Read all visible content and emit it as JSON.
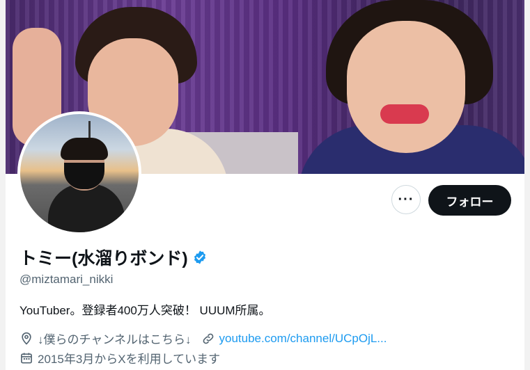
{
  "profile": {
    "display_name": "トミー(水溜りボンド)",
    "handle": "@miztamari_nikki",
    "bio": "YouTuber。登録者400万人突破！ UUUM所属。",
    "location": "↓僕らのチャンネルはこちら↓",
    "website": "youtube.com/channel/UCpOjL...",
    "joined": "2015年3月からXを利用しています",
    "verified": true
  },
  "actions": {
    "more_label": "···",
    "follow_label": "フォロー"
  },
  "colors": {
    "accent": "#1d9bf0",
    "text_primary": "#0f1419",
    "text_secondary": "#536471",
    "button_dark": "#0f1419"
  },
  "icons": {
    "location": "location-pin-icon",
    "link": "link-icon",
    "calendar": "calendar-icon",
    "verified": "verified-badge-icon",
    "more": "more-dots-icon"
  }
}
